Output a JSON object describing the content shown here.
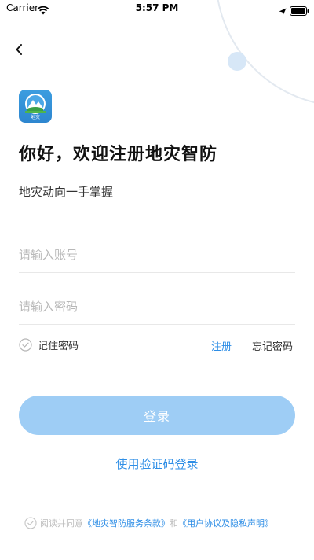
{
  "status_bar": {
    "carrier": "Carrier",
    "time": "5:57 PM"
  },
  "app": {
    "logo_text": "地灾"
  },
  "header": {
    "title": "你好，欢迎注册地灾智防",
    "subtitle": "地灾动向一手掌握"
  },
  "form": {
    "account_placeholder": "请输入账号",
    "password_placeholder": "请输入密码",
    "remember_label": "记住密码",
    "register_label": "注册",
    "forgot_label": "忘记密码",
    "login_label": "登录",
    "code_login_label": "使用验证码登录"
  },
  "agreement": {
    "prefix": "阅读并同意",
    "terms": "《地灾智防服务条款》",
    "conjunction": "和",
    "privacy": "《用户协议及隐私声明》"
  },
  "colors": {
    "accent": "#2e8ee6",
    "login_button": "#9ecdf5",
    "decoration": "#dfe8f2",
    "decoration_dot": "#d7e7f7"
  }
}
